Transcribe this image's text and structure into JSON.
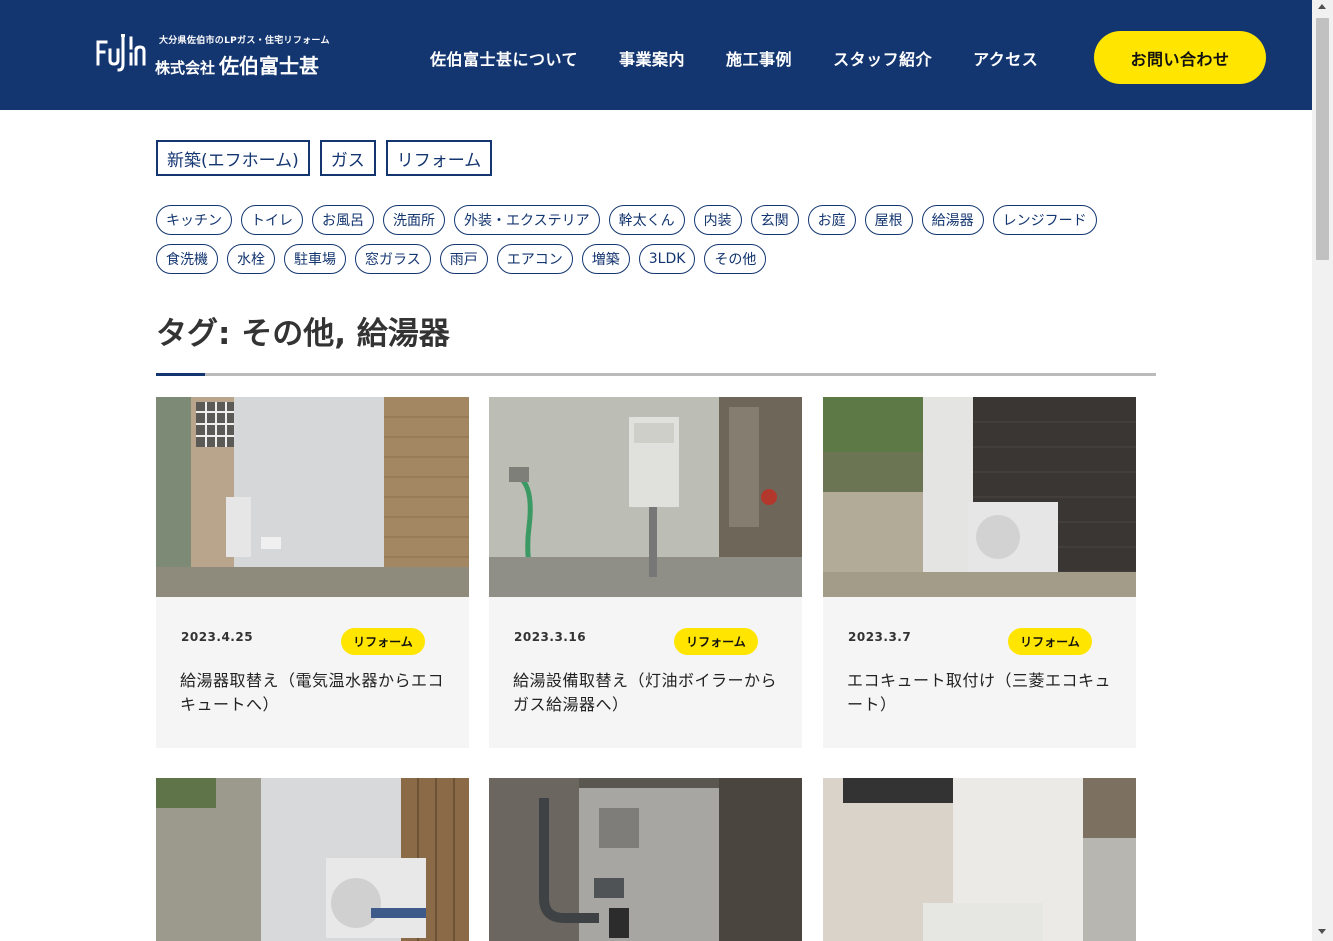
{
  "header": {
    "logo_sub": "大分県佐伯市のLPガス・住宅リフォーム",
    "logo_company_type": "株式会社",
    "logo_company_name": "佐伯富士甚",
    "nav": [
      "佐伯富士甚について",
      "事業案内",
      "施工事例",
      "スタッフ紹介",
      "アクセス"
    ],
    "contact_label": "お問い合わせ"
  },
  "categories": [
    "新築(エフホーム)",
    "ガス",
    "リフォーム"
  ],
  "tags": [
    "キッチン",
    "トイレ",
    "お風呂",
    "洗面所",
    "外装・エクステリア",
    "幹太くん",
    "内装",
    "玄関",
    "お庭",
    "屋根",
    "給湯器",
    "レンジフード",
    "食洗機",
    "水栓",
    "駐車場",
    "窓ガラス",
    "雨戸",
    "エアコン",
    "増築",
    "3LDK",
    "その他"
  ],
  "page_title": "タグ: その他, 給湯器",
  "posts": [
    {
      "date": "2023.4.25",
      "category": "リフォーム",
      "title": "給湯器取替え（電気温水器からエコキュートへ）"
    },
    {
      "date": "2023.3.16",
      "category": "リフォーム",
      "title": "給湯設備取替え（灯油ボイラーからガス給湯器へ）"
    },
    {
      "date": "2023.3.7",
      "category": "リフォーム",
      "title": "エコキュート取付け（三菱エコキュート）"
    },
    {
      "date": "",
      "category": "",
      "title": ""
    },
    {
      "date": "",
      "category": "",
      "title": ""
    },
    {
      "date": "",
      "category": "",
      "title": ""
    }
  ],
  "colors": {
    "navy": "#143670",
    "yellow": "#ffe500",
    "card_bg": "#f5f5f5"
  }
}
